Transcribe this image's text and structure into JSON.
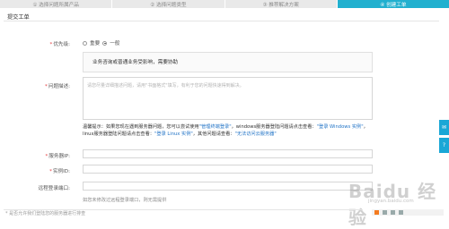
{
  "steps": [
    {
      "label": "① 选择问题所属产品",
      "active": false
    },
    {
      "label": "② 选择问题类型",
      "active": false
    },
    {
      "label": "③ 推荐解决方案",
      "active": false
    },
    {
      "label": "④ 创建工单",
      "active": true
    }
  ],
  "section_title": "提交工单",
  "priority": {
    "label": "优先级:",
    "options": [
      "重要",
      "一般"
    ],
    "selected": "一般"
  },
  "tip_text": "业务咨询或普通业务受影响，需要协助",
  "problem": {
    "label": "问题描述:",
    "placeholder": "请您尽量详细描述问题，请用\"书面格式\"填写，有利于您的问题快速得到解决。"
  },
  "hint": {
    "prefix": "温馨提示：如果您现在遇到服务器问题，您可以尝试使用",
    "link1": "\"管理终端登录\"",
    "mid1": "，windows服务器登陆问题请点击查看：",
    "link2": "\"登录 Windows 实例\"",
    "mid2": "，linux服务器登陆问题请点击查看：",
    "link3": "\"登录 Linux 实例\"",
    "mid3": "，其他问题请查看：",
    "link4": "\"无法访问云服务器\""
  },
  "fields": {
    "server_ip": "服务器IP:",
    "instance_id": "实例ID:",
    "remote_port": "远程登录端口:",
    "remote_note": "如您未修改过远程登录端口，则无需提供"
  },
  "bottom_text": "* 是否允许我们登陆您的服务器进行排查",
  "watermark": "Baidu 经验",
  "watermark_url": "jingyan.baidu.com",
  "accent": "#21b0cf",
  "side_tabs": [
    {
      "icon": "chat-icon"
    },
    {
      "icon": "question-icon"
    }
  ]
}
